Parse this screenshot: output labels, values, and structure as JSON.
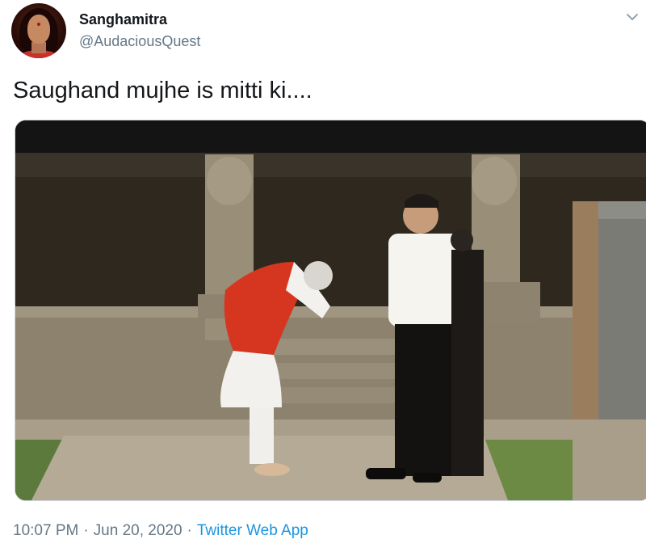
{
  "tweet": {
    "author": {
      "display_name": "Sanghamitra",
      "handle": "@AudaciousQuest"
    },
    "text": "Saughand mujhe is mitti ki....",
    "time": "10:07 PM",
    "date": "Jun 20, 2020",
    "separator": "·",
    "source_app": "Twitter Web App"
  },
  "icons": {
    "menu": "chevron-down-icon"
  },
  "colors": {
    "link": "#1b95e0",
    "secondary_text": "#657786",
    "primary_text": "#14171a"
  }
}
